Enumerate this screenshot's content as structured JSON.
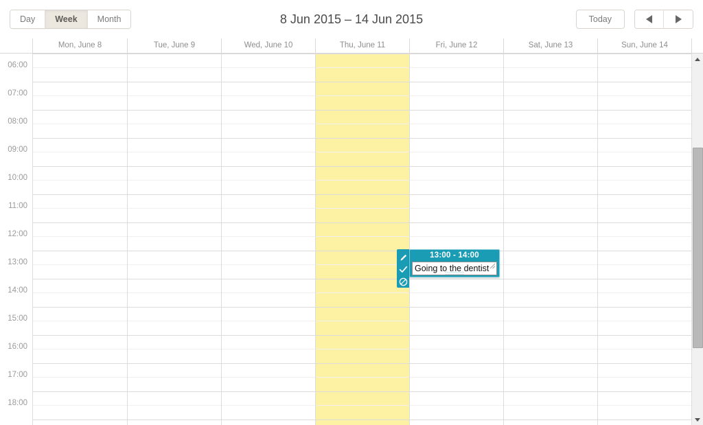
{
  "toolbar": {
    "views": [
      {
        "label": "Day",
        "active": false
      },
      {
        "label": "Week",
        "active": true
      },
      {
        "label": "Month",
        "active": false
      }
    ],
    "title": "8 Jun 2015 – 14 Jun 2015",
    "today_label": "Today",
    "prev_label": "◀",
    "next_label": "▶"
  },
  "calendar": {
    "days": [
      {
        "label": "Mon, June 8",
        "today": false
      },
      {
        "label": "Tue, June 9",
        "today": false
      },
      {
        "label": "Wed, June 10",
        "today": false
      },
      {
        "label": "Thu, June 11",
        "today": true
      },
      {
        "label": "Fri, June 12",
        "today": false
      },
      {
        "label": "Sat, June 13",
        "today": false
      },
      {
        "label": "Sun, June 14",
        "today": false
      }
    ],
    "time_labels": [
      "06:00",
      "07:00",
      "08:00",
      "09:00",
      "10:00",
      "11:00",
      "12:00",
      "13:00",
      "14:00",
      "15:00",
      "16:00",
      "17:00",
      "18:00"
    ],
    "today_highlight_color": "#fdf1a4",
    "grid_line_color": "#dcdcdc",
    "half_hour_line_color": "#f0f0f0"
  },
  "event": {
    "time_range": "13:00 - 14:00",
    "text_value": "Going to the dentist",
    "text_placeholder": "",
    "day": "Fri, June 12",
    "accent_color": "#1a9cb5",
    "tools": [
      {
        "name": "edit-icon",
        "title": "Edit"
      },
      {
        "name": "accept-icon",
        "title": "Accept"
      },
      {
        "name": "cancel-icon",
        "title": "Cancel"
      }
    ]
  },
  "scrollbar": {
    "up_label": "▲",
    "down_label": "▼"
  }
}
